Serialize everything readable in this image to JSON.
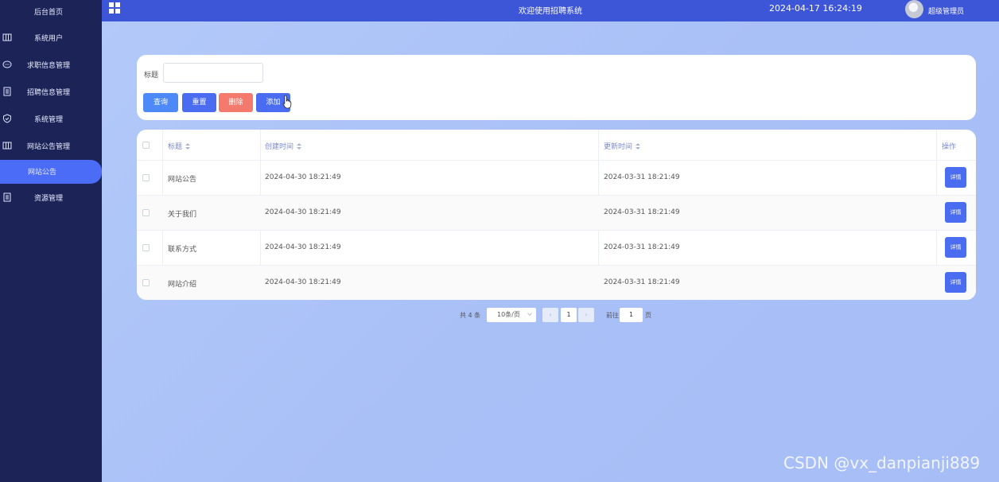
{
  "sidebar": {
    "items": [
      {
        "label": "后台首页",
        "icon": "none"
      },
      {
        "label": "系统用户",
        "icon": "columns-icon"
      },
      {
        "label": "求职信息管理",
        "icon": "chat-icon"
      },
      {
        "label": "招聘信息管理",
        "icon": "document-icon"
      },
      {
        "label": "系统管理",
        "icon": "shield-icon"
      },
      {
        "label": "网站公告管理",
        "icon": "columns-icon"
      },
      {
        "label": "网站公告",
        "icon": "none",
        "active": true
      },
      {
        "label": "资源管理",
        "icon": "document-icon"
      }
    ]
  },
  "topbar": {
    "title": "欢迎使用招聘系统",
    "datetime": "2024-04-17 16:24:19",
    "user": "超级管理员"
  },
  "search": {
    "label": "标题",
    "value": "",
    "buttons": {
      "query": "查询",
      "reset": "重置",
      "delete": "删除",
      "add": "添加"
    }
  },
  "table": {
    "headers": {
      "title": "标题",
      "created": "创建时间",
      "updated": "更新时间",
      "actions": "操作"
    },
    "rows": [
      {
        "title": "网站公告",
        "created": "2024-04-30 18:21:49",
        "updated": "2024-03-31 18:21:49",
        "action": "详情"
      },
      {
        "title": "关于我们",
        "created": "2024-04-30 18:21:49",
        "updated": "2024-03-31 18:21:49",
        "action": "详情"
      },
      {
        "title": "联系方式",
        "created": "2024-04-30 18:21:49",
        "updated": "2024-03-31 18:21:49",
        "action": "详情"
      },
      {
        "title": "网站介绍",
        "created": "2024-04-30 18:21:49",
        "updated": "2024-03-31 18:21:49",
        "action": "详情"
      }
    ]
  },
  "pagination": {
    "total": "共 4 条",
    "page_size": "10条/页",
    "prev": "‹",
    "current": "1",
    "next": "›",
    "goto_label": "前往",
    "goto_value": "1",
    "page_suffix": "页"
  },
  "watermark": "CSDN @vx_danpianji889",
  "colors": {
    "sidebar_bg": "#1c2457",
    "topbar_bg": "#3d56d8",
    "accent": "#4a6cf0",
    "danger": "#f57a6e"
  }
}
